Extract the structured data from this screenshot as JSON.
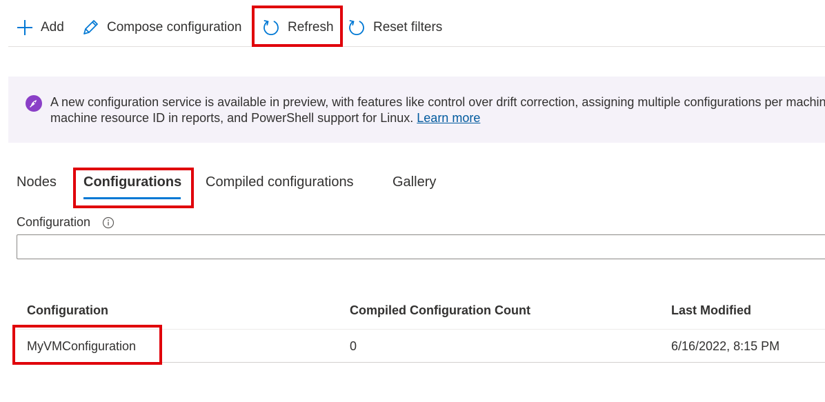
{
  "toolbar": {
    "add_label": "Add",
    "compose_label": "Compose configuration",
    "refresh_label": "Refresh",
    "reset_label": "Reset filters",
    "accent_color": "#0078d4"
  },
  "banner": {
    "text_line1": "A new configuration service is available in preview, with features like control over drift correction, assigning multiple configurations per machine,",
    "text_line2": "machine resource ID in reports, and PowerShell support for Linux.",
    "link_label": "Learn more",
    "icon": "rocket-icon",
    "icon_color": "#8a3fc7",
    "background": "#f5f2f9"
  },
  "tabs": [
    {
      "label": "Nodes",
      "active": false
    },
    {
      "label": "Configurations",
      "active": true
    },
    {
      "label": "Compiled configurations",
      "active": false
    },
    {
      "label": "Gallery",
      "active": false
    }
  ],
  "filter": {
    "label": "Configuration",
    "value": "",
    "placeholder": ""
  },
  "table": {
    "columns": [
      "Configuration",
      "Compiled Configuration Count",
      "Last Modified"
    ],
    "rows": [
      [
        "MyVMConfiguration",
        "0",
        "6/16/2022, 8:15 PM"
      ]
    ]
  },
  "highlight_color": "#e0000a"
}
